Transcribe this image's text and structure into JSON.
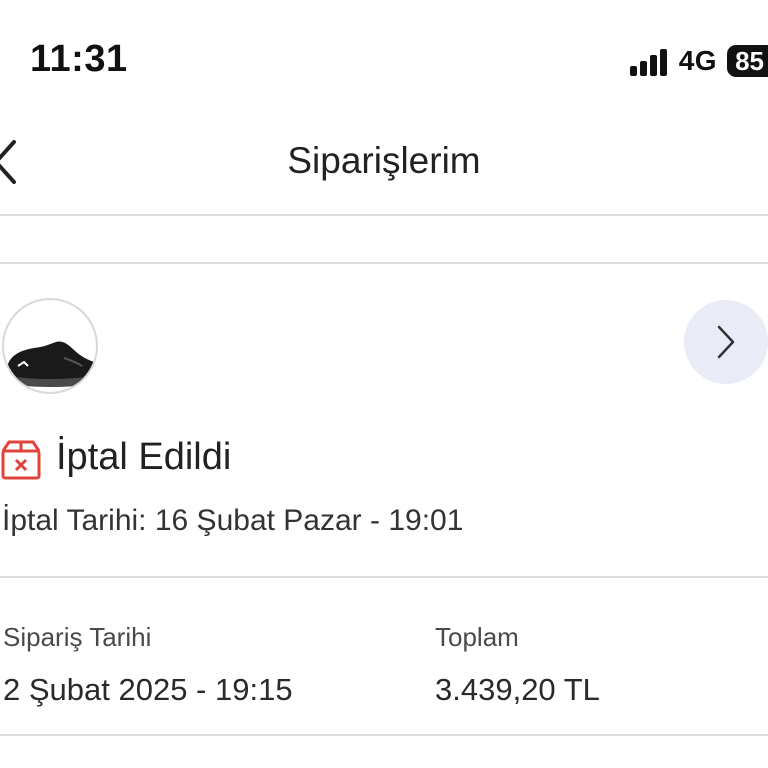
{
  "status_bar": {
    "time": "11:31",
    "network": "4G",
    "battery": "85",
    "icons": [
      "signal-bars-icon",
      "battery-icon"
    ]
  },
  "header": {
    "title": "Siparişlerim",
    "back_icon": "chevron-left-icon"
  },
  "order": {
    "product_image": "black-sneaker-thumbnail",
    "detail_icon": "chevron-right-icon",
    "status": {
      "label": "İptal Edildi",
      "icon": "cancelled-package-icon",
      "color": "#e0443c"
    },
    "cancel_date": "İptal Tarihi: 16 Şubat Pazar - 19:01",
    "order_date_label": "Sipariş Tarihi",
    "order_date_value": "2 Şubat 2025 - 19:15",
    "total_label": "Toplam",
    "total_value": "3.439,20 TL"
  },
  "colors": {
    "accent_bg": "#e9ebf7",
    "divider": "#dcdcdc",
    "cancel_red": "#e0443c"
  }
}
